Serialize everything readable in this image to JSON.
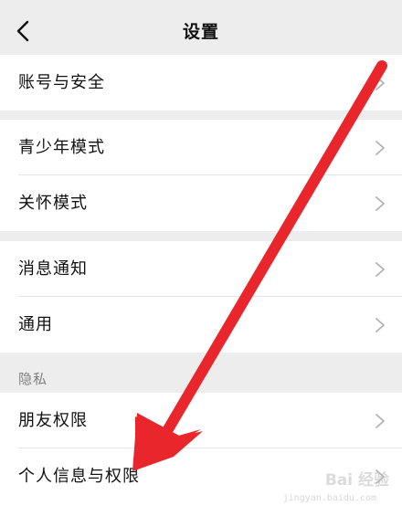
{
  "header": {
    "title": "设置",
    "back_icon": "chevron-left-icon"
  },
  "groups": [
    {
      "items": [
        {
          "label": "账号与安全"
        }
      ]
    },
    {
      "items": [
        {
          "label": "青少年模式"
        },
        {
          "label": "关怀模式"
        }
      ]
    },
    {
      "items": [
        {
          "label": "消息通知"
        },
        {
          "label": "通用"
        }
      ]
    }
  ],
  "privacy": {
    "section_label": "隐私",
    "items": [
      {
        "label": "朋友权限"
      },
      {
        "label": "个人信息与权限"
      }
    ]
  },
  "annotation": {
    "arrow_color": "#e8262c"
  },
  "watermark": {
    "text": "Bai 经验",
    "subtext": "jingyan.baidu.com"
  },
  "colors": {
    "background": "#ededed",
    "item_background": "#ffffff",
    "chevron": "#b2b2b2"
  }
}
